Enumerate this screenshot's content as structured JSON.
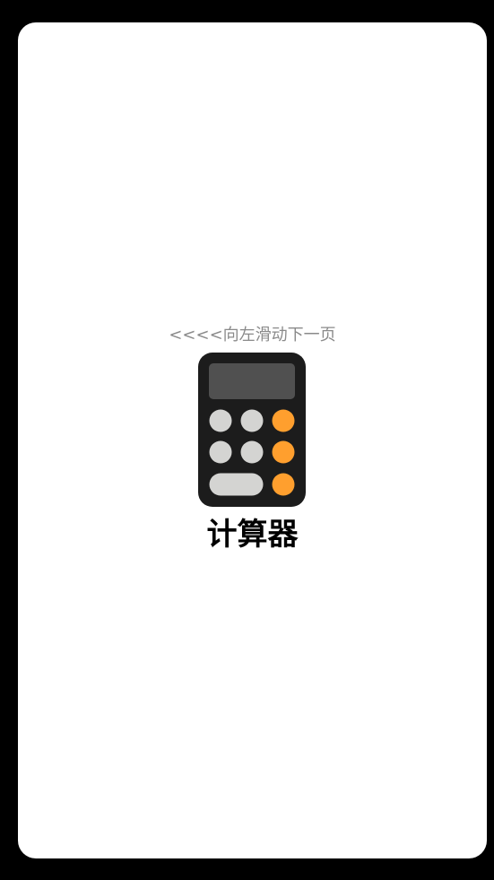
{
  "page": {
    "swipe_hint": "<<<<向左滑动下一页",
    "app": {
      "name": "计算器",
      "icon": "calculator-icon"
    }
  },
  "colors": {
    "background": "#000000",
    "screen": "#ffffff",
    "hint_text": "#8a8a8a",
    "icon_body": "#1c1c1c",
    "icon_display": "#505050",
    "icon_gray_key": "#d4d4d2",
    "icon_orange_key": "#ff9f2e"
  }
}
